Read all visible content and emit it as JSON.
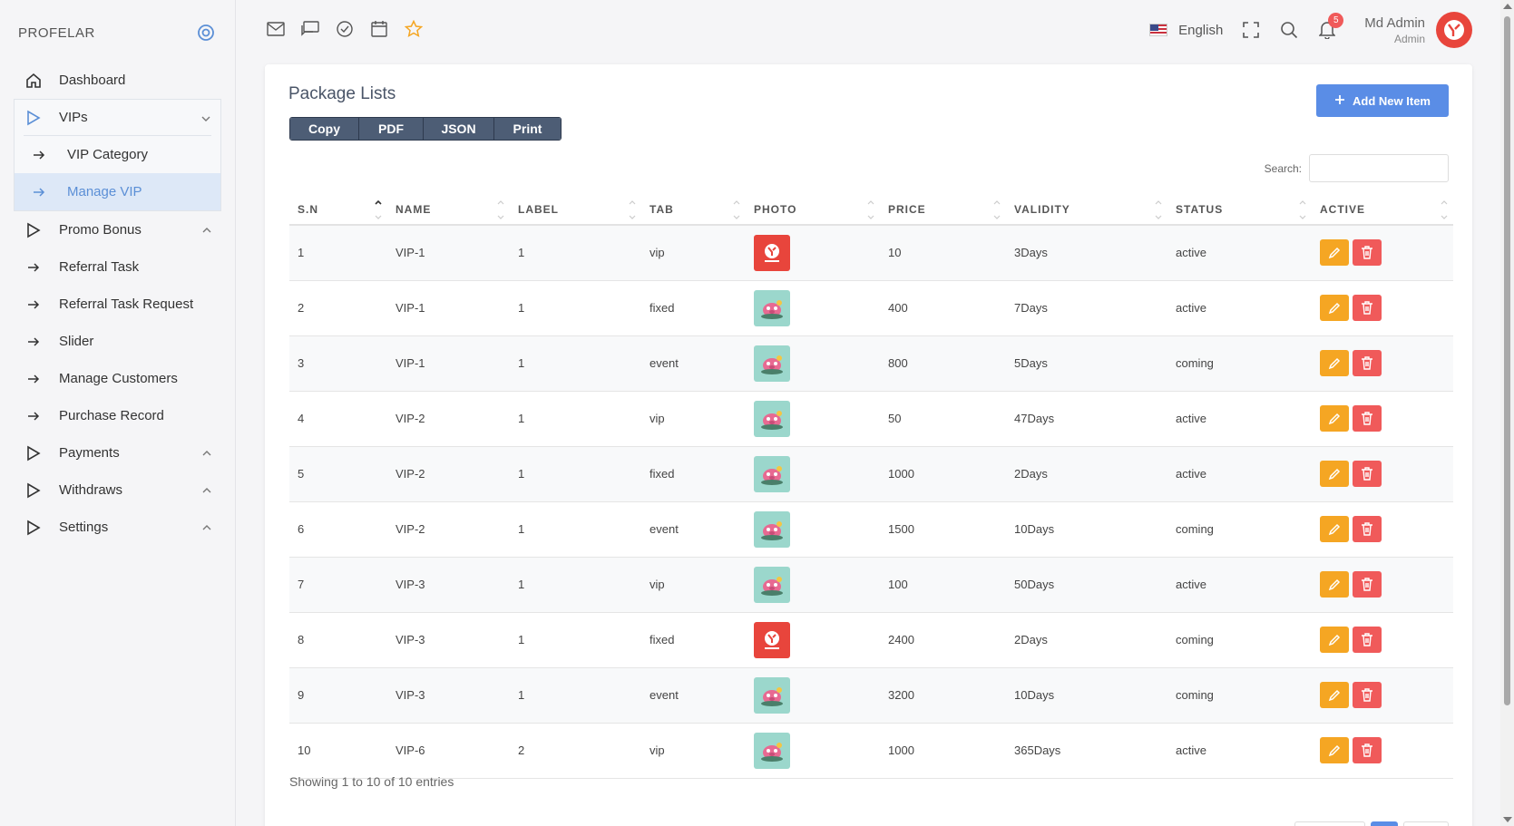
{
  "brand": "PROFELAR",
  "sidebar": {
    "items": [
      {
        "label": "Dashboard",
        "icon": "home-icon"
      },
      {
        "label": "VIPs",
        "icon": "play-icon",
        "expanded": true,
        "children": [
          {
            "label": "VIP Category",
            "icon": "arrow-right-icon"
          },
          {
            "label": "Manage VIP",
            "icon": "arrow-right-icon",
            "active": true
          }
        ]
      },
      {
        "label": "Promo Bonus",
        "icon": "play-icon"
      },
      {
        "label": "Referral Task",
        "icon": "arrow-right-icon"
      },
      {
        "label": "Referral Task Request",
        "icon": "arrow-right-icon"
      },
      {
        "label": "Slider",
        "icon": "arrow-right-icon"
      },
      {
        "label": "Manage Customers",
        "icon": "arrow-right-icon"
      },
      {
        "label": "Purchase Record",
        "icon": "arrow-right-icon"
      },
      {
        "label": "Payments",
        "icon": "play-icon"
      },
      {
        "label": "Withdraws",
        "icon": "play-icon"
      },
      {
        "label": "Settings",
        "icon": "play-icon"
      }
    ]
  },
  "topbar": {
    "icons": [
      "mail-icon",
      "chat-icon",
      "check-circle-icon",
      "calendar-icon",
      "star-icon"
    ],
    "language": "English",
    "notifications_count": "5",
    "user_name": "Md Admin",
    "user_role": "Admin"
  },
  "colors": {
    "accent": "#5a8de6",
    "edit": "#f5a623",
    "delete": "#f05a5a",
    "export": "#4d5d75"
  },
  "card": {
    "title": "Package Lists",
    "add_button": "Add New Item",
    "export_buttons": [
      "Copy",
      "PDF",
      "JSON",
      "Print"
    ],
    "search_label": "Search:",
    "search_value": ""
  },
  "table": {
    "columns": [
      "S.N",
      "NAME",
      "LABEL",
      "TAB",
      "PHOTO",
      "PRICE",
      "VALIDITY",
      "STATUS",
      "ACTIVE"
    ],
    "rows": [
      {
        "sn": "1",
        "name": "VIP-1",
        "label": "1",
        "tab": "vip",
        "photo": "logo",
        "price": "10",
        "validity": "3Days",
        "status": "active"
      },
      {
        "sn": "2",
        "name": "VIP-1",
        "label": "1",
        "tab": "fixed",
        "photo": "pig",
        "price": "400",
        "validity": "7Days",
        "status": "active"
      },
      {
        "sn": "3",
        "name": "VIP-1",
        "label": "1",
        "tab": "event",
        "photo": "pig",
        "price": "800",
        "validity": "5Days",
        "status": "coming"
      },
      {
        "sn": "4",
        "name": "VIP-2",
        "label": "1",
        "tab": "vip",
        "photo": "pig",
        "price": "50",
        "validity": "47Days",
        "status": "active"
      },
      {
        "sn": "5",
        "name": "VIP-2",
        "label": "1",
        "tab": "fixed",
        "photo": "pig",
        "price": "1000",
        "validity": "2Days",
        "status": "active"
      },
      {
        "sn": "6",
        "name": "VIP-2",
        "label": "1",
        "tab": "event",
        "photo": "pig",
        "price": "1500",
        "validity": "10Days",
        "status": "coming"
      },
      {
        "sn": "7",
        "name": "VIP-3",
        "label": "1",
        "tab": "vip",
        "photo": "pig",
        "price": "100",
        "validity": "50Days",
        "status": "active"
      },
      {
        "sn": "8",
        "name": "VIP-3",
        "label": "1",
        "tab": "fixed",
        "photo": "logo",
        "price": "2400",
        "validity": "2Days",
        "status": "coming"
      },
      {
        "sn": "9",
        "name": "VIP-3",
        "label": "1",
        "tab": "event",
        "photo": "pig",
        "price": "3200",
        "validity": "10Days",
        "status": "coming"
      },
      {
        "sn": "10",
        "name": "VIP-6",
        "label": "2",
        "tab": "vip",
        "photo": "pig",
        "price": "1000",
        "validity": "365Days",
        "status": "active"
      }
    ],
    "footer": "Showing 1 to 10 of 10 entries"
  }
}
